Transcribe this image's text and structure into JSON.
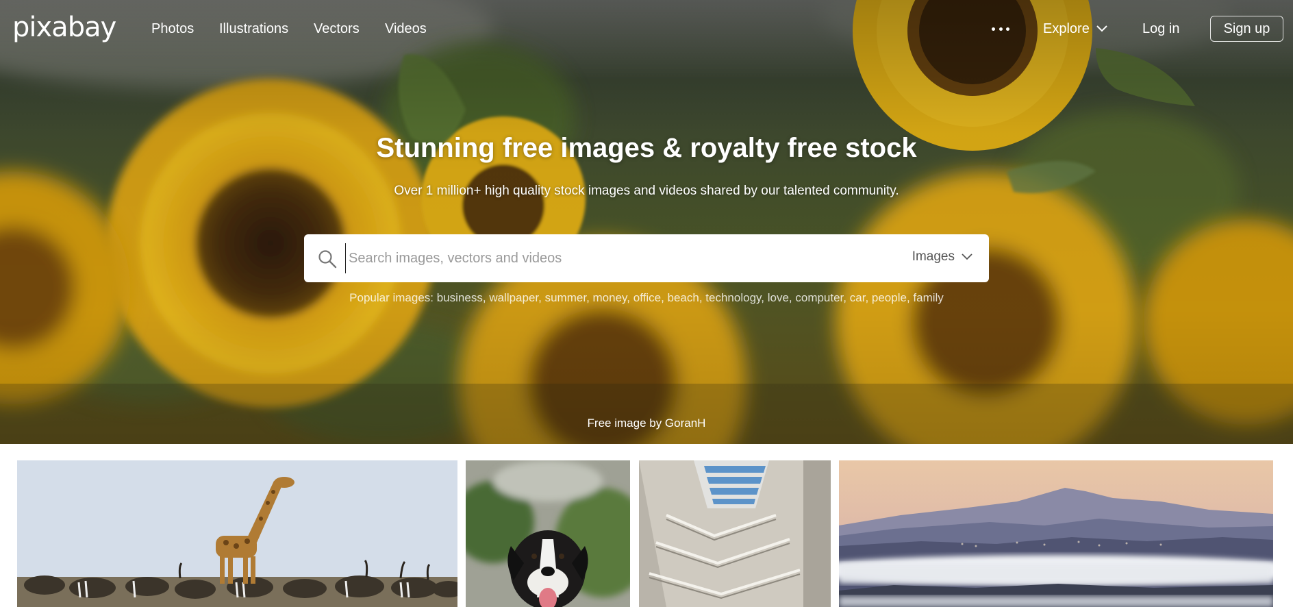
{
  "brand": {
    "logo_text": "pixabay"
  },
  "nav": {
    "links": [
      "Photos",
      "Illustrations",
      "Vectors",
      "Videos"
    ],
    "more_icon": "more-dots-icon",
    "explore_label": "Explore",
    "login_label": "Log in",
    "signup_label": "Sign up"
  },
  "hero": {
    "title": "Stunning free images & royalty free stock",
    "subtitle": "Over 1 million+ high quality stock images and videos shared by our talented community.",
    "search": {
      "placeholder": "Search images, vectors and videos",
      "value": "",
      "type_label": "Images",
      "icon": "search-icon"
    },
    "popular": {
      "label": "Popular images:",
      "terms": [
        "business",
        "wallpaper",
        "summer",
        "money",
        "office",
        "beach",
        "technology",
        "love",
        "computer",
        "car",
        "people",
        "family"
      ]
    },
    "credit": "Free image by GoranH"
  },
  "gallery": {
    "tiles": [
      {
        "subject": "giraffe-zebras-savanna"
      },
      {
        "subject": "boxer-dog"
      },
      {
        "subject": "stairwell-skylight"
      },
      {
        "subject": "mountain-valley-fog"
      }
    ]
  },
  "colors": {
    "hero_base": "#3a3a1e",
    "sunflower_yellow": "#e8b415",
    "sunflower_center": "#4a2f0d",
    "text_light": "#ffffff",
    "search_bg": "#ffffff"
  }
}
